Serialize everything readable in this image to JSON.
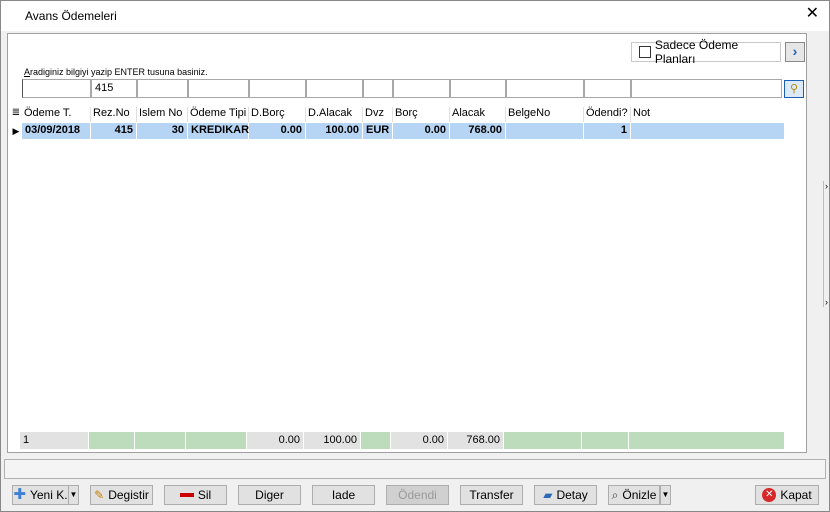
{
  "window": {
    "title": "Avans Ödemeleri",
    "close_glyph": "✕"
  },
  "search": {
    "only_plans_label": "Sadece Ödeme Planları",
    "nav_glyph": "›",
    "hint_prefix": "A",
    "hint_rest": "radiginiz bilgiyi yazip ENTER tusuna basiniz.",
    "filters": [
      "",
      "415",
      "",
      "",
      "",
      "",
      "",
      "",
      "",
      "",
      "",
      ""
    ]
  },
  "grid": {
    "columns": [
      "Ödeme T.",
      "Rez.No",
      "Islem No",
      "Ödeme Tipi",
      "D.Borç",
      "D.Alacak",
      "Dvz",
      "Borç",
      "Alacak",
      "BelgeNo",
      "Ödendi?",
      "Not"
    ],
    "rows": [
      [
        "03/09/2018",
        "415",
        "30",
        "KREDIKART",
        "0.00",
        "100.00",
        "EUR",
        "0.00",
        "768.00",
        "",
        "1",
        ""
      ]
    ],
    "footer": [
      "1",
      "",
      "",
      "",
      "0.00",
      "100.00",
      "",
      "0.00",
      "768.00",
      "",
      "",
      ""
    ]
  },
  "buttons": {
    "new": "Yeni K.",
    "edit": "Degistir",
    "delete": "Sil",
    "other": "Diger",
    "refund": "Iade",
    "paid": "Ödendi",
    "transfer": "Transfer",
    "detail": "Detay",
    "preview": "Önizle",
    "close": "Kapat"
  },
  "colors": {
    "selected_row": "#b6d4f4",
    "footer_green": "#bcdcbc",
    "accent": "#1a5fb4"
  }
}
